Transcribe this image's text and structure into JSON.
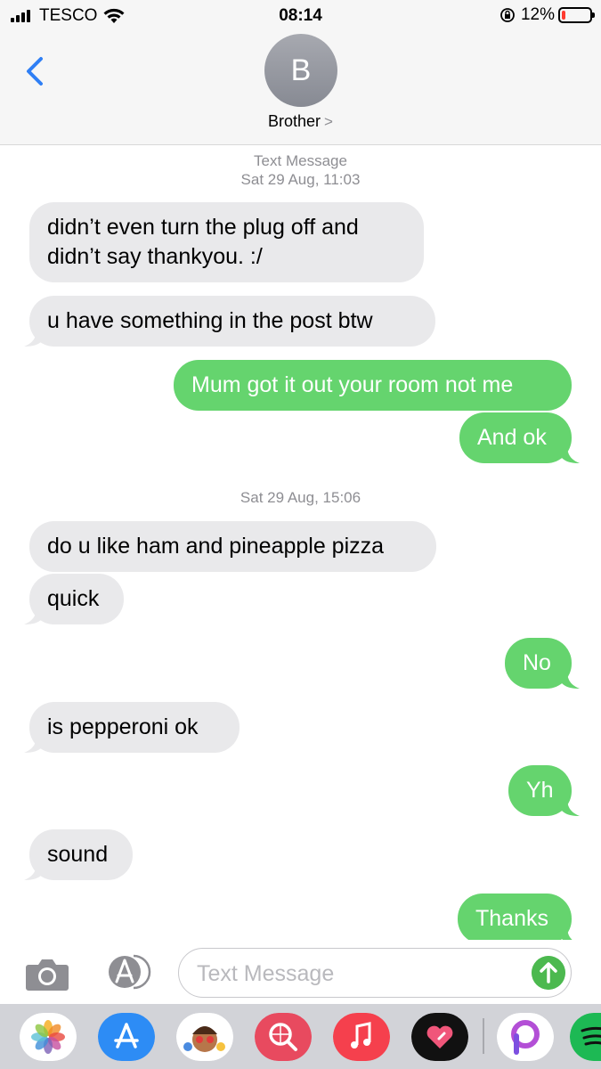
{
  "status_bar": {
    "carrier": "TESCO",
    "time": "08:14",
    "battery_percent": "12%",
    "battery_level": 0.12
  },
  "header": {
    "avatar_initial": "B",
    "contact_name": "Brother",
    "contact_chevron": ">"
  },
  "messages": {
    "ts1_line1": "Text Message",
    "ts1_line2": "Sat 29 Aug, 11:03",
    "m1_line1": "didn’t even turn the plug off and",
    "m1_line2": "didn’t say thankyou. :/",
    "m2": "u have something in the post btw",
    "m3": "Mum got it out your room not me",
    "m4": "And ok",
    "ts2": "Sat 29 Aug, 15:06",
    "m5": "do u like ham and pineapple pizza",
    "m6": "quick",
    "m7": "No",
    "m8": "is pepperoni ok",
    "m9": "Yh",
    "m10": "sound",
    "m11": "Thanks"
  },
  "input": {
    "placeholder": "Text Message"
  },
  "app_drawer": {
    "apps": [
      "photos-icon",
      "app-store-icon",
      "memoji-icon",
      "web-search-icon",
      "music-icon",
      "heart-app-icon",
      "picsart-icon",
      "spotify-icon"
    ]
  },
  "colors": {
    "outgoing_bubble": "#65d46e",
    "incoming_bubble": "#e9e9eb",
    "link_blue": "#2f7ff5",
    "send_button": "#4cb94f"
  }
}
